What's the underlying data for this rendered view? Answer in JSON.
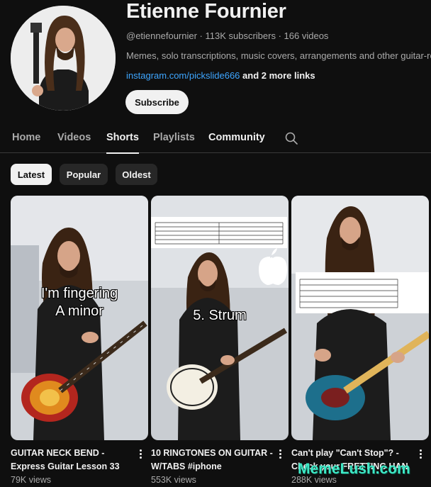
{
  "channel": {
    "name": "Etienne Fournier",
    "handle": "@etiennefournier",
    "subscribers": "113K subscribers",
    "videos": "166 videos",
    "separator": " · ",
    "description": "Memes, solo transcriptions, music covers, arrangements and other guitar-re",
    "link": "instagram.com/pickslide666",
    "more_links": " and 2 more links",
    "subscribe_label": "Subscribe"
  },
  "tabs": [
    {
      "label": "Home",
      "active": false
    },
    {
      "label": "Videos",
      "active": false
    },
    {
      "label": "Shorts",
      "active": true
    },
    {
      "label": "Playlists",
      "active": false
    },
    {
      "label": "Community",
      "active": false
    }
  ],
  "search_icon": "search-icon",
  "filters": [
    {
      "label": "Latest",
      "selected": true
    },
    {
      "label": "Popular",
      "selected": false
    },
    {
      "label": "Oldest",
      "selected": false
    }
  ],
  "shorts": [
    {
      "title_line1": "GUITAR NECK BEND -",
      "title_line2": "Express Guitar Lesson 33",
      "views": "79K views",
      "overlay_line1": "I'm fingering",
      "overlay_line2": "A minor"
    },
    {
      "title_line1": "10 RINGTONES ON GUITAR -",
      "title_line2": "W/TABS #iphone",
      "views": "553K views",
      "overlay_line1": "5. Strum"
    },
    {
      "title_line1": "Can't play \"Can't Stop\"? -",
      "title_line2": "Check your FRETTING HAN",
      "views": "288K views"
    }
  ],
  "watermark": "MemeLush.com",
  "colors": {
    "background": "#0f0f0f",
    "link": "#3ea6ff",
    "secondary_text": "#aaaaaa",
    "chip_bg": "#272727"
  }
}
